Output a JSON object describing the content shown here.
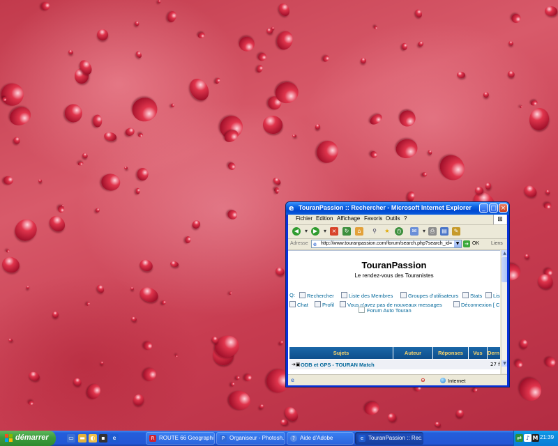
{
  "window": {
    "title": "TouranPassion :: Rechercher - Microsoft Internet Explorer",
    "menu": [
      "Fichier",
      "Edition",
      "Affichage",
      "Favoris",
      "Outils",
      "?"
    ],
    "address_label": "Adresse",
    "url": "http://www.touranpassion.com/forum/search.php?search_id=",
    "go_label": "OK",
    "links_label": "Liens",
    "status_zone": "Internet"
  },
  "page": {
    "site_title": "TouranPassion",
    "site_subtitle": "Le rendez-vous des Touranistes",
    "nav_prefix": "Q:",
    "nav_row1": [
      "Rechercher",
      "Liste des Membres",
      "Groupes d'utilisateurs",
      "Stats",
      "List"
    ],
    "nav_row2": [
      "Chat",
      "Profil",
      "Vous n'avez pas de nouveaux messages",
      "Déconnexion [ C"
    ],
    "forum_filter": "Forum Auto Touran",
    "table_headers": [
      "Sujets",
      "Auteur",
      "Réponses",
      "Vus",
      "Dern"
    ],
    "row_title": "ODB et GPS - TOURAN Match",
    "row_last": "27 ft"
  },
  "taskbar": {
    "start_label": "démarrer",
    "tasks": [
      "ROUTE 66 Geographi...",
      "Organiseur - Photosh...",
      "Aide d'Adobe",
      "TouranPassion :: Rec..."
    ],
    "clock": "21:39"
  },
  "colors": {
    "desktop": "#c8404f",
    "title_bar": "#0a5fe0",
    "taskbar": "#245edb",
    "start_button": "#3c9c3c",
    "link": "#006699",
    "table_header": "#1b67a8",
    "table_header_text": "#ffd86a"
  }
}
